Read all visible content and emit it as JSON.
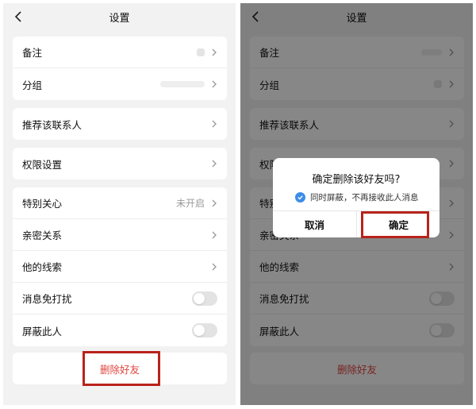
{
  "settings": {
    "title": "设置",
    "rows_card1": [
      {
        "label": "备注"
      },
      {
        "label": "分组"
      }
    ],
    "recommend": {
      "label": "推荐该联系人"
    },
    "permission": {
      "label": "权限设置"
    },
    "rows_card4": [
      {
        "label": "特别关心",
        "value": "未开启"
      },
      {
        "label": "亲密关系"
      },
      {
        "label": "他的线索"
      },
      {
        "label": "消息免打扰"
      },
      {
        "label": "屏蔽此人"
      }
    ],
    "delete_label": "删除好友"
  },
  "dialog": {
    "title": "确定删除该好友吗?",
    "checkbox_label": "同时屏蔽，不再接收此人消息",
    "cancel_label": "取消",
    "confirm_label": "确定"
  },
  "toggles": {
    "do_not_disturb": false,
    "block_person": false
  },
  "checkbox_checked": true,
  "colors": {
    "delete_text": "#e0433c",
    "highlight_border": "#b8231c",
    "check_blue": "#3d8ce8"
  }
}
